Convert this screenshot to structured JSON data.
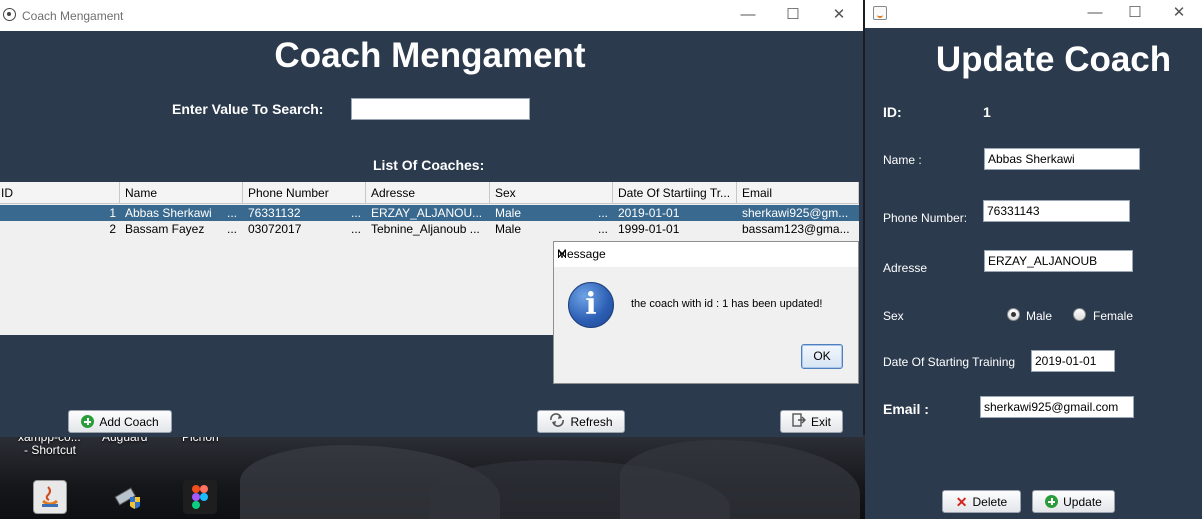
{
  "main_window": {
    "title": "Coach Mengament",
    "heading": "Coach Mengament",
    "search_label": "Enter Value To Search:",
    "search_value": "",
    "list_heading": "List Of Coaches:",
    "columns": [
      "ID",
      "Name",
      "Phone Number",
      "Adresse",
      "Sex",
      "Date Of Startiing Tr...",
      "Email"
    ],
    "rows": [
      {
        "id": "1",
        "name": "Abbas Sherkawi",
        "phone": "76331132",
        "adresse": "ERZAY_ALJANOU...",
        "sex": "Male",
        "date": "2019-01-01",
        "email": "sherkawi925@gm..."
      },
      {
        "id": "2",
        "name": "Bassam Fayez",
        "phone": "03072017",
        "adresse": "Tebnine_Aljanoub ...",
        "sex": "Male",
        "date": "1999-01-01",
        "email": "bassam123@gma..."
      }
    ],
    "ellipsis": "...",
    "buttons": {
      "add": "Add Coach",
      "refresh": "Refresh",
      "exit": "Exit"
    }
  },
  "dialog": {
    "title": "Message",
    "message": "the coach with id : 1 has been updated!",
    "ok": "OK",
    "icon": "info-icon"
  },
  "update_window": {
    "heading": "Update Coach",
    "id_label": "ID:",
    "id_value": "1",
    "name_label": "Name :",
    "name_value": "Abbas Sherkawi",
    "phone_label": "Phone Number:",
    "phone_value": "76331143",
    "adresse_label": "Adresse",
    "adresse_value": "ERZAY_ALJANOUB",
    "sex_label": "Sex",
    "sex_options": [
      "Male",
      "Female"
    ],
    "sex_selected": "Male",
    "date_label": "Date Of Starting Training",
    "date_value": "2019-01-01",
    "email_label": "Email :",
    "email_value": "sherkawi925@gmail.com",
    "buttons": {
      "delete": "Delete",
      "update": "Update"
    }
  },
  "desktop": {
    "labels": [
      "xampp-co...",
      "Auguard",
      "Pichon",
      "- Shortcut"
    ]
  },
  "colors": {
    "window_bg": "#2b3a4d",
    "selected_row": "#39698f",
    "dialog_bg": "#f0f0f0"
  }
}
